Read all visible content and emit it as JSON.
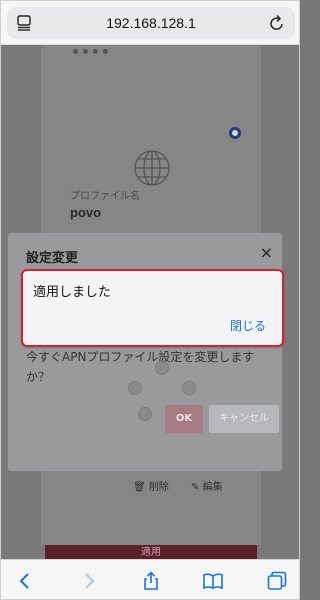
{
  "browser": {
    "url": "192.168.128.1",
    "reader_icon": "reader-icon",
    "reload_icon": "reload-icon"
  },
  "background_page": {
    "masked_text": "••••",
    "profile_label": "プロファイル名",
    "profile_name": "povo",
    "delete_label": "削除",
    "edit_label": "編集",
    "apply_label": "適用"
  },
  "dialog": {
    "title": "設定変更",
    "close_glyph": "×",
    "message": "今すぐAPNプロファイル設定を変更しますか？",
    "ok_label": "OK",
    "cancel_label": "キャンセル"
  },
  "alert": {
    "message": "適用しました",
    "close_label": "閉じる"
  },
  "colors": {
    "alert_border": "#d81f33",
    "link_blue": "#1573d6",
    "ios_blue": "#1a73e8"
  }
}
